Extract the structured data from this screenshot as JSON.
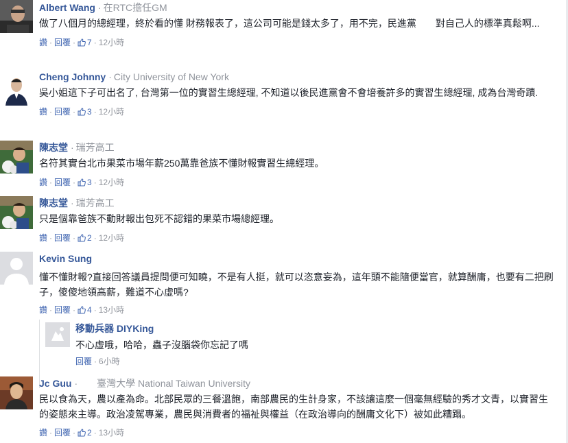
{
  "comments": [
    {
      "name": "Albert Wang",
      "subtitle": "在RTC擔任GM",
      "text": "做了八個月的總經理，終於看的懂 財務報表了，這公司可能是錢太多了，用不完，民進黨　　對自己人的標準真鬆啊...",
      "actions": {
        "like": "讚",
        "reply": "回覆",
        "likes": "7",
        "time": "12小時"
      }
    },
    {
      "name": "Cheng Johnny",
      "subtitle": "City University of New York",
      "text": "吳小姐這下子可出名了, 台灣第一位的實習生總經理, 不知道以後民進黨會不會培養許多的實習生總經理, 成為台灣奇蹟.",
      "actions": {
        "like": "讚",
        "reply": "回覆",
        "likes": "3",
        "time": "12小時"
      }
    },
    {
      "name": "陳志堂",
      "subtitle": "瑞芳高工",
      "text": "名符其實台北市果菜市場年薪250萬靠爸族不懂財報實習生總經理。",
      "actions": {
        "like": "讚",
        "reply": "回覆",
        "likes": "3",
        "time": "12小時"
      }
    },
    {
      "name": "陳志堂",
      "subtitle": "瑞芳高工",
      "text": "只是個靠爸族不動財報出包死不認錯的果菜市場總經理。",
      "actions": {
        "like": "讚",
        "reply": "回覆",
        "likes": "2",
        "time": "12小時"
      }
    },
    {
      "name": "Kevin Sung",
      "subtitle": "",
      "text": "懂不懂財報?直接回答議員提問便可知曉，不是有人挺，就可以恣意妄為，這年頭不能隨便當官，就算酬庸，也要有二把刷子，傻傻地領高薪，難道不心虛嗎?",
      "actions": {
        "like": "讚",
        "reply": "回覆",
        "likes": "4",
        "time": "13小時"
      }
    },
    {
      "name": "Jc Guu",
      "subtitle": "臺灣大學 National Taiwan University",
      "text": "民以食為天，農以產為命。北部民眾的三餐溫飽，南部農民的生計身家，不該讓這麼一個毫無經驗的秀才文青，以實習生的姿態來主導。政治凌駕專業，農民與消費者的福祉與權益（在政治導向的酬庸文化下）被如此糟蹋。",
      "actions": {
        "like": "讚",
        "reply": "回覆",
        "likes": "2",
        "time": "13小時"
      }
    }
  ],
  "reply": {
    "name": "移動兵器 DIYKing",
    "text": "不心虛哦，哈哈，蟲子沒腦袋你忘記了嗎",
    "actions": {
      "reply": "回覆",
      "time": "6小時"
    }
  },
  "colors": {
    "link": "#365899",
    "action": "#4267b2",
    "meta": "#90949c",
    "text": "#1d2129"
  }
}
